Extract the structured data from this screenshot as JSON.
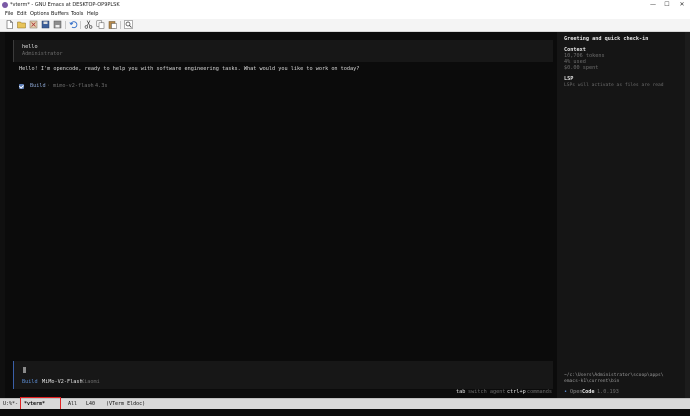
{
  "window": {
    "title": "*vterm* - GNU Emacs at DESKTOP-OP9PLSK",
    "controls": {
      "minimize": "—",
      "maximize": "☐",
      "close": "✕"
    }
  },
  "menu": {
    "items": [
      "File",
      "Edit",
      "Options",
      "Buffers",
      "Tools",
      "Help"
    ]
  },
  "toolbar": {
    "icons": [
      "new-file-icon",
      "open-folder-icon",
      "save-icon",
      "close-buffer-icon",
      "undo-icon",
      "cut-icon",
      "copy-icon",
      "paste-icon",
      "search-icon"
    ]
  },
  "chat": {
    "user_message": "hello",
    "user_name": "Administrator",
    "reply": "Hello! I'm opencode, ready to help you with software engineering tasks. What would you like to work on today?",
    "status": {
      "mode": "Build",
      "separator": "·",
      "model": "mimo-v2-flash",
      "duration": "4.3s"
    },
    "input": {
      "mode": "Build",
      "model": "MiMo-V2-Flash",
      "provider": "Xiaomi"
    },
    "hints": {
      "tab_key": "tab",
      "tab_action": "switch agent",
      "ctrlp_key": "ctrl+p",
      "ctrlp_action": "commands"
    }
  },
  "sidebar": {
    "session_title": "Greeting and quick check-in",
    "context_heading": "Context",
    "context_tokens": "10,706 tokens",
    "context_used": "4% used",
    "context_cost": "$0.00 spent",
    "lsp_heading": "LSP",
    "lsp_text": "LSPs will activate as files are read",
    "path_line1": "~/c:\\Users\\Administrator\\scoop\\apps\\",
    "path_line2": "emacs-k1\\current\\bin",
    "brand_dot": "•",
    "brand_open": "Open",
    "brand_code": "Code",
    "version": "1.0.193"
  },
  "modeline": {
    "status": "U:%*-",
    "buffer": "*vterm*",
    "position": "All",
    "line": "L40",
    "mode": "(VTerm Eldoc)"
  },
  "colors": {
    "background": "#0b0b0b",
    "panel": "#171717",
    "sidebar": "#151515",
    "accent": "#5e7fb8",
    "text": "#e6e6e6",
    "muted": "#6e6e6e",
    "highlight": "#e02020"
  }
}
